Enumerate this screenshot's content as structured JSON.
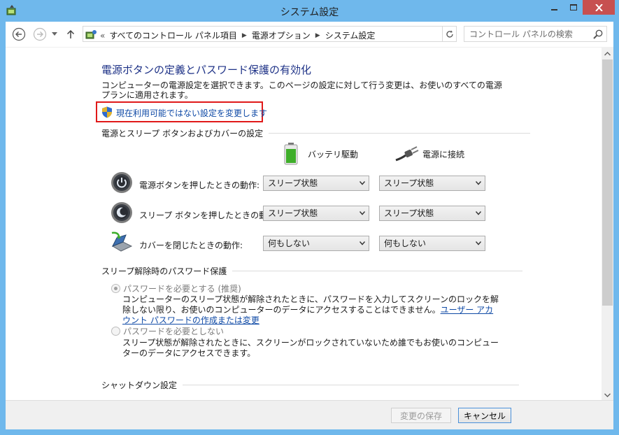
{
  "window": {
    "title": "システム設定",
    "accent": "#6fb8ec",
    "close_color": "#c75050"
  },
  "nav": {
    "back_icon": "back-arrow-icon",
    "forward_icon": "forward-arrow-icon",
    "up_icon": "up-arrow-icon",
    "overflow": "«",
    "breadcrumb": [
      "すべてのコントロール パネル項目",
      "電源オプション",
      "システム設定"
    ],
    "search_placeholder": "コントロール パネルの検索"
  },
  "page": {
    "heading": "電源ボタンの定義とパスワード保護の有効化",
    "description": "コンピューターの電源設定を選択できます。このページの設定に対して行う変更は、お使いのすべての電源プランに適用されます。",
    "change_settings_link": "現在利用可能ではない設定を変更します"
  },
  "power_section": {
    "title": "電源とスリープ ボタンおよびカバーの設定",
    "columns": [
      "バッテリ駆動",
      "電源に接続"
    ],
    "rows": [
      {
        "label": "電源ボタンを押したときの動作:",
        "battery": "スリープ状態",
        "plugged": "スリープ状態"
      },
      {
        "label": "スリープ ボタンを押したときの動作:",
        "battery": "スリープ状態",
        "plugged": "スリープ状態"
      },
      {
        "label": "カバーを閉じたときの動作:",
        "battery": "何もしない",
        "plugged": "何もしない"
      }
    ]
  },
  "password_section": {
    "title": "スリープ解除時のパスワード保護",
    "options": [
      {
        "label": "パスワードを必要とする (推奨)",
        "selected": true,
        "desc1": "コンピューターのスリープ状態が解除されたときに、パスワードを入力してスクリーンのロックを解除しない限り、お使いのコンピューターのデータにアクセスすることはできません。",
        "link": "ユーザー アカウント パスワードの作成または変更"
      },
      {
        "label": "パスワードを必要としない",
        "selected": false,
        "desc1": "スリープ状態が解除されたときに、スクリーンがロックされていないため誰でもお使いのコンピューターのデータにアクセスできます。"
      }
    ]
  },
  "shutdown_section": {
    "title": "シャットダウン設定"
  },
  "footer": {
    "save_label": "変更の保存",
    "cancel_label": "キャンセル"
  }
}
